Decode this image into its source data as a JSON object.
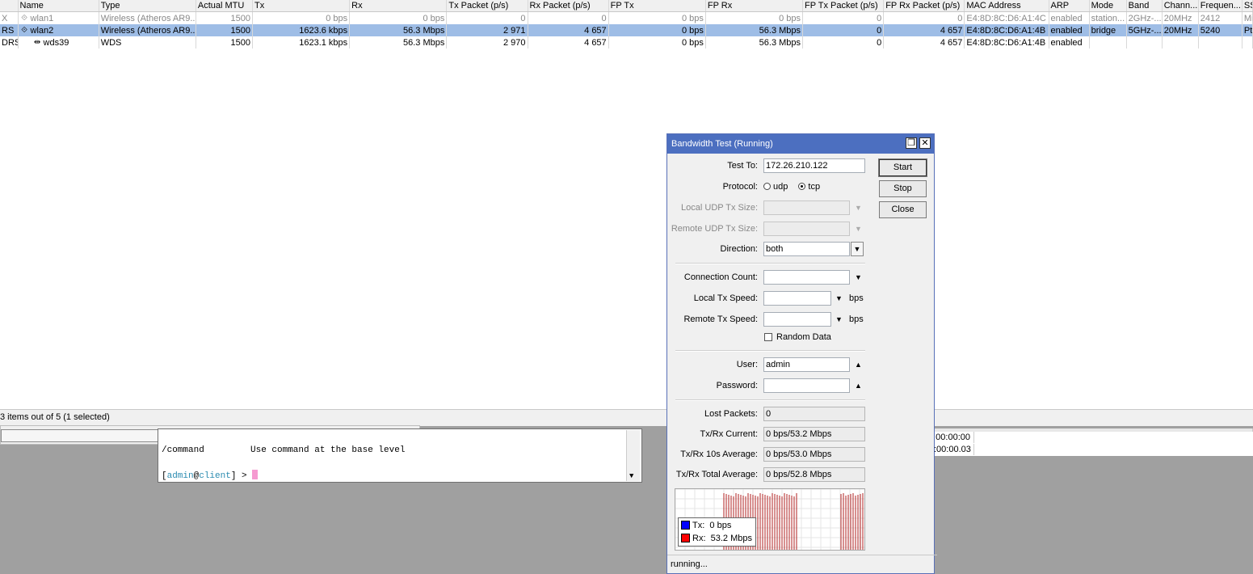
{
  "interfaces": {
    "columns": [
      "",
      "Name",
      "Type",
      "Actual MTU",
      "Tx",
      "Rx",
      "Tx Packet (p/s)",
      "Rx Packet (p/s)",
      "FP Tx",
      "FP Rx",
      "FP Tx Packet (p/s)",
      "FP Rx Packet (p/s)",
      "MAC Address",
      "ARP",
      "Mode",
      "Band",
      "Chann...",
      "Frequen...",
      "SS"
    ],
    "rows": [
      {
        "flags": "X",
        "name": "wlan1",
        "type": "Wireless (Atheros AR9...",
        "mtu": "1500",
        "tx": "0 bps",
        "rx": "0 bps",
        "txp": "0",
        "rxp": "0",
        "fptx": "0 bps",
        "fprx": "0 bps",
        "fptxp": "0",
        "fprxp": "0",
        "mac": "E4:8D:8C:D6:A1:4C",
        "arp": "enabled",
        "mode": "station...",
        "band": "2GHz-...",
        "chan": "20MHz",
        "freq": "2412",
        "ss": "Mi"
      },
      {
        "flags": "RS",
        "name": "wlan2",
        "type": "Wireless (Atheros AR9...",
        "mtu": "1500",
        "tx": "1623.6 kbps",
        "rx": "56.3 Mbps",
        "txp": "2 971",
        "rxp": "4 657",
        "fptx": "0 bps",
        "fprx": "56.3 Mbps",
        "fptxp": "0",
        "fprxp": "4 657",
        "mac": "E4:8D:8C:D6:A1:4B",
        "arp": "enabled",
        "mode": "bridge",
        "band": "5GHz-...",
        "chan": "20MHz",
        "freq": "5240",
        "ss": "Pt"
      },
      {
        "flags": "DRS",
        "name": "wds39",
        "type": "WDS",
        "mtu": "1500",
        "tx": "1623.1 kbps",
        "rx": "56.3 Mbps",
        "txp": "2 970",
        "rxp": "4 657",
        "fptx": "0 bps",
        "fprx": "56.3 Mbps",
        "fptxp": "0",
        "fprxp": "4 657",
        "mac": "E4:8D:8C:D6:A1:4B",
        "arp": "enabled",
        "mode": "",
        "band": "",
        "chan": "",
        "freq": "",
        "ss": ""
      }
    ],
    "status": "3 items out of 5 (1 selected)"
  },
  "terminal": {
    "line1_cmd": "/command",
    "line1_desc": "Use command at the base level",
    "prompt_open": "[",
    "prompt_user": "admin",
    "prompt_at": "@",
    "prompt_host": "client",
    "prompt_close": "] > "
  },
  "right_table": {
    "rows": [
      "00:00:00",
      ":00:00.03"
    ]
  },
  "dialog": {
    "title": "Bandwidth Test (Running)",
    "restore_glyph": "❐",
    "close_glyph": "✕",
    "buttons": {
      "start": "Start",
      "stop": "Stop",
      "close": "Close"
    },
    "labels": {
      "test_to": "Test To:",
      "protocol": "Protocol:",
      "local_udp": "Local UDP Tx Size:",
      "remote_udp": "Remote UDP Tx Size:",
      "direction": "Direction:",
      "conn_count": "Connection Count:",
      "local_speed": "Local Tx Speed:",
      "remote_speed": "Remote Tx Speed:",
      "random_data": "Random Data",
      "user": "User:",
      "password": "Password:",
      "lost": "Lost Packets:",
      "current": "Tx/Rx Current:",
      "avg10": "Tx/Rx 10s Average:",
      "total": "Tx/Rx Total Average:"
    },
    "values": {
      "test_to": "172.26.210.122",
      "protocol_udp": "udp",
      "protocol_tcp": "tcp",
      "protocol_selected": "tcp",
      "direction": "both",
      "bps": "bps",
      "user": "admin",
      "password": "",
      "lost": "0",
      "current": "0 bps/53.2 Mbps",
      "avg10": "0 bps/53.0 Mbps",
      "total": "0 bps/52.8 Mbps"
    },
    "legend": {
      "tx_label": "Tx:",
      "tx_value": "0 bps",
      "tx_color": "#0000ff",
      "rx_label": "Rx:",
      "rx_value": "53.2 Mbps",
      "rx_color": "#ff0000"
    },
    "graph_bar_color": "#b02020",
    "status": "running..."
  }
}
